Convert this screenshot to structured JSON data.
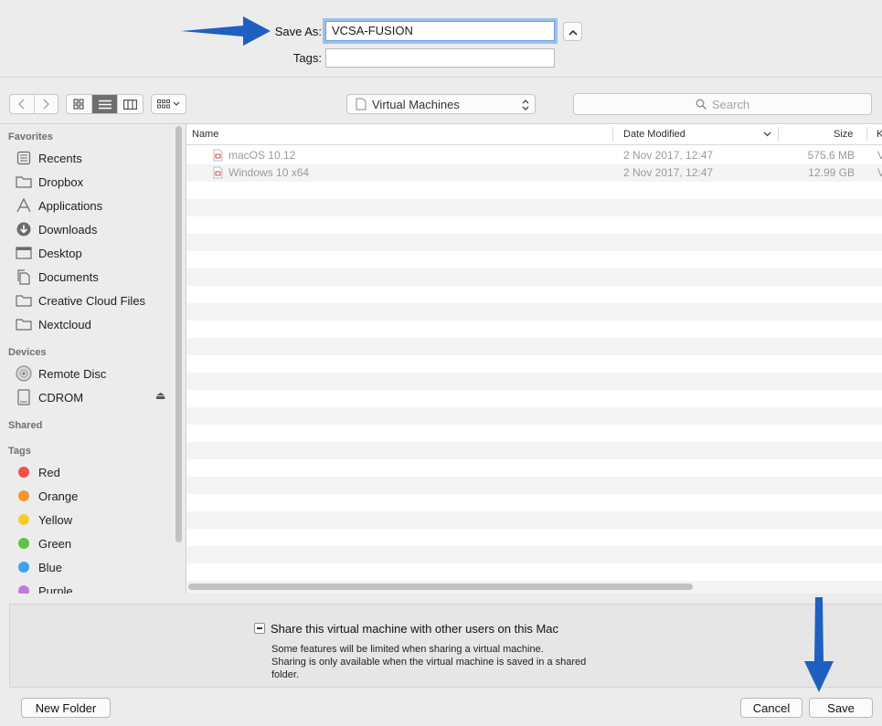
{
  "header": {
    "save_as_label": "Save As:",
    "save_as_value": "VCSA-FUSION",
    "tags_label": "Tags:",
    "tags_value": "",
    "expand_glyph": "^"
  },
  "toolbar": {
    "back_glyph": "‹",
    "forward_glyph": "›",
    "view_modes": [
      "icon-view",
      "list-view",
      "column-view"
    ],
    "active_view": "list-view",
    "arrange_glyph": "▾",
    "location": "Virtual Machines",
    "search_placeholder": "Search"
  },
  "sidebar": {
    "favorites_header": "Favorites",
    "favorites": [
      {
        "label": "Recents",
        "icon": "recents-icon"
      },
      {
        "label": "Dropbox",
        "icon": "folder-icon"
      },
      {
        "label": "Applications",
        "icon": "applications-icon"
      },
      {
        "label": "Downloads",
        "icon": "downloads-icon"
      },
      {
        "label": "Desktop",
        "icon": "desktop-icon"
      },
      {
        "label": "Documents",
        "icon": "documents-icon"
      },
      {
        "label": "Creative Cloud Files",
        "icon": "folder-icon"
      },
      {
        "label": "Nextcloud",
        "icon": "folder-icon"
      }
    ],
    "devices_header": "Devices",
    "devices": [
      {
        "label": "Remote Disc",
        "icon": "disc-icon"
      },
      {
        "label": "CDROM",
        "icon": "drive-icon",
        "eject_glyph": "⏏"
      }
    ],
    "shared_header": "Shared",
    "tags_header": "Tags",
    "tags": [
      {
        "label": "Red",
        "color": "#f0504a"
      },
      {
        "label": "Orange",
        "color": "#f5962c"
      },
      {
        "label": "Yellow",
        "color": "#f6cb2f"
      },
      {
        "label": "Green",
        "color": "#5cc343"
      },
      {
        "label": "Blue",
        "color": "#3ba4f0"
      },
      {
        "label": "Purple",
        "color": "#c47bd8"
      }
    ]
  },
  "file_list": {
    "columns": {
      "name": "Name",
      "date": "Date Modified",
      "size": "Size",
      "kind": "K"
    },
    "rows": [
      {
        "name": "macOS 10.12",
        "date": "2 Nov 2017, 12:47",
        "size": "575.6 MB",
        "kind": "V"
      },
      {
        "name": "Windows 10 x64",
        "date": "2 Nov 2017, 12:47",
        "size": "12.99 GB",
        "kind": "V"
      }
    ]
  },
  "options": {
    "share_label": "Share this virtual machine with other users on this Mac",
    "share_checked": false,
    "note_line1": "Some features will be limited when sharing a virtual machine.",
    "note_line2": "Sharing is only available when the virtual machine is saved in a shared",
    "note_line3": "folder."
  },
  "footer": {
    "new_folder_label": "New Folder",
    "cancel_label": "Cancel",
    "save_label": "Save"
  },
  "annotation_color": "#1f5fc0"
}
